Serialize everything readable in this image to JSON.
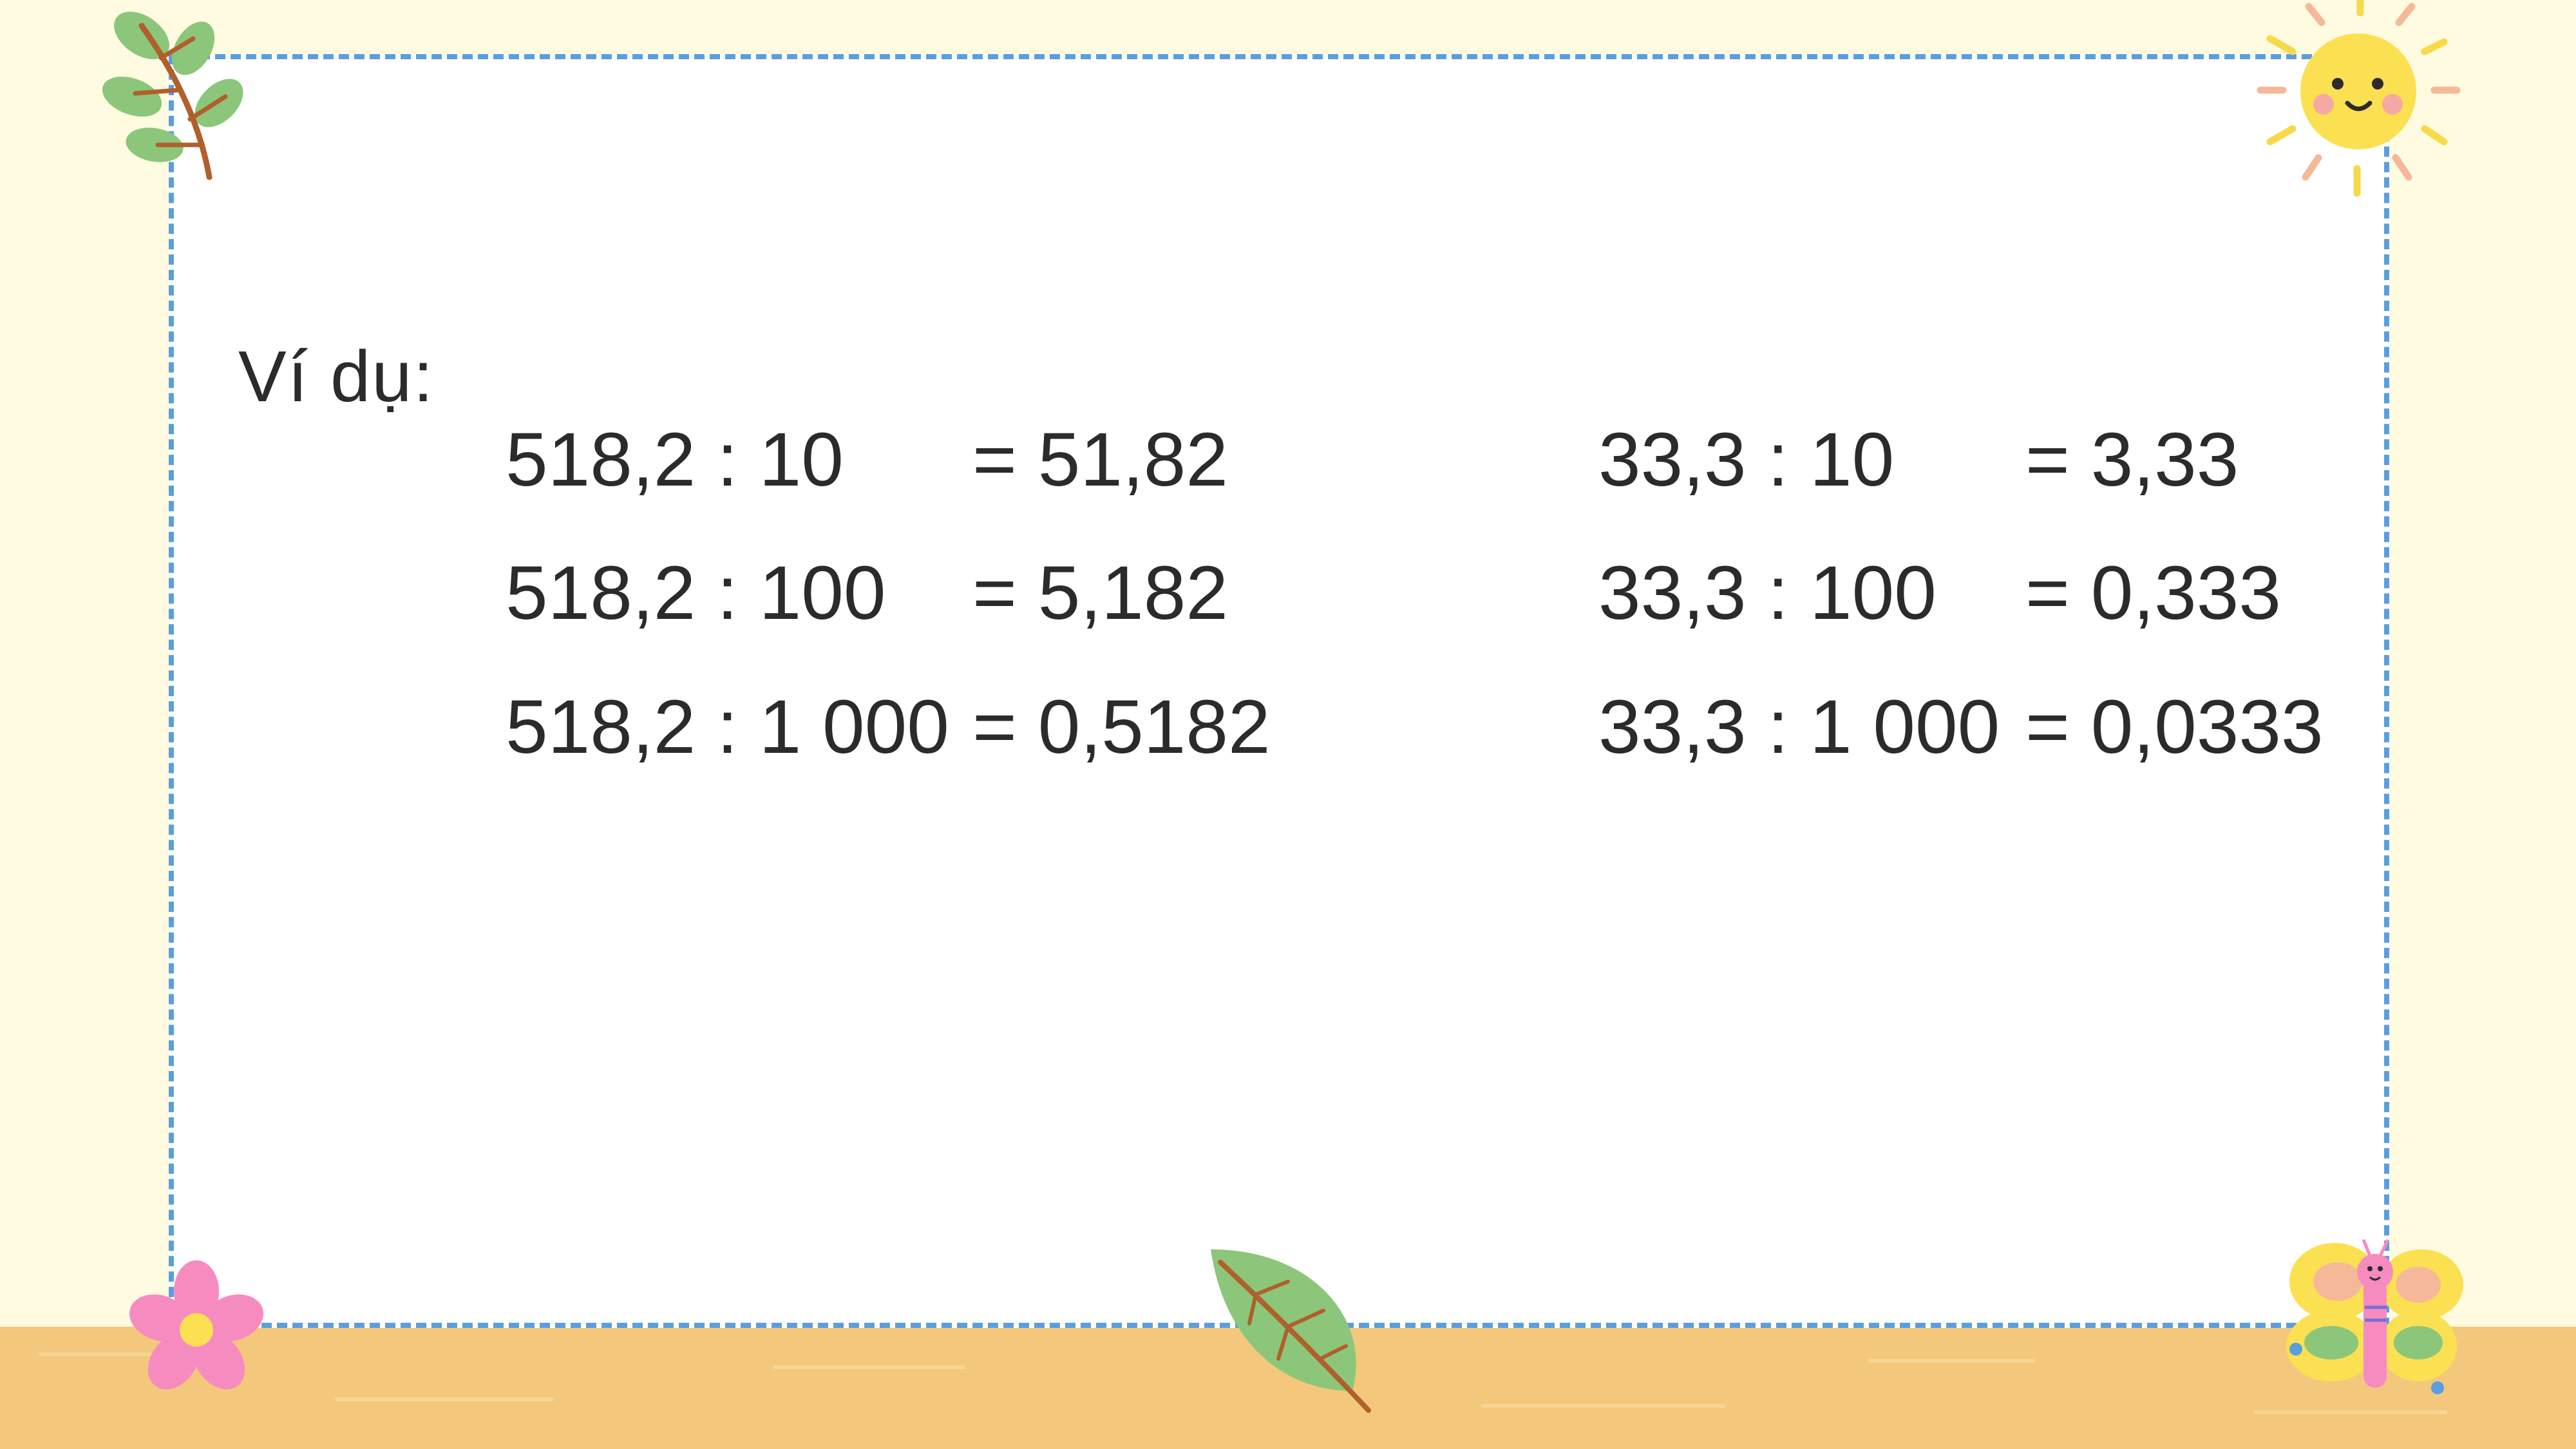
{
  "example_label": "Ví dụ:",
  "left_column": [
    {
      "expr": "518,2 : 10",
      "result": "= 51,82"
    },
    {
      "expr": "518,2 : 100",
      "result": "= 5,182"
    },
    {
      "expr": "518,2 : 1 000",
      "result": "= 0,5182"
    }
  ],
  "right_column": [
    {
      "expr": "33,3 : 10",
      "result": "= 3,33"
    },
    {
      "expr": "33,3 : 100",
      "result": "= 0,333"
    },
    {
      "expr": "33,3 : 1 000",
      "result": "= 0,0333"
    }
  ],
  "colors": {
    "background": "#fefbe0",
    "ground": "#f3c87c",
    "frame_border": "#5b9ee0",
    "text": "#2b2b2b"
  },
  "decorations": [
    "branch-icon",
    "sun-icon",
    "flower-icon",
    "leaf-icon",
    "butterfly-icon"
  ]
}
